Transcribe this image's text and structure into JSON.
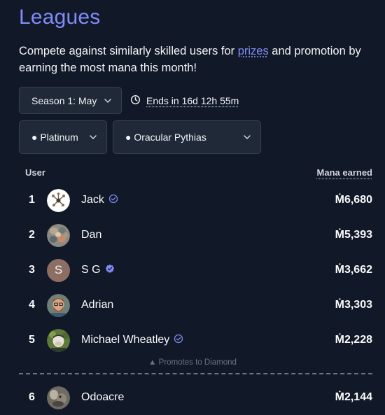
{
  "page": {
    "title": "Leagues",
    "description_before": "Compete against similarly skilled users for ",
    "description_link": "prizes",
    "description_after": " and promotion by earning the most mana this month!"
  },
  "controls": {
    "season": "Season 1: May",
    "ends": "Ends in 16d 12h 55m",
    "division": "● Platinum",
    "cohort": "● Oracular Pythias"
  },
  "table": {
    "col_user": "User",
    "col_mana": "Mana earned",
    "promote_note": "▲ Promotes to Diamond",
    "rows": [
      {
        "rank": "1",
        "name": "Jack",
        "badge": "verified-outline",
        "mana": "Ṁ6,680",
        "avatar": "jack"
      },
      {
        "rank": "2",
        "name": "Dan",
        "badge": "none",
        "mana": "Ṁ5,393",
        "avatar": "dan"
      },
      {
        "rank": "3",
        "name": "S G",
        "badge": "verified-filled",
        "mana": "Ṁ3,662",
        "avatar": "initial",
        "initial": "S"
      },
      {
        "rank": "4",
        "name": "Adrian",
        "badge": "none",
        "mana": "Ṁ3,303",
        "avatar": "adrian"
      },
      {
        "rank": "5",
        "name": "Michael Wheatley",
        "badge": "verified-outline",
        "mana": "Ṁ2,228",
        "avatar": "michael"
      },
      {
        "rank": "6",
        "name": "Odoacre",
        "badge": "none",
        "mana": "Ṁ2,144",
        "avatar": "odoacre"
      }
    ]
  },
  "colors": {
    "background": "#111827",
    "accent": "#818cf8",
    "control_bg": "#1f2937"
  }
}
